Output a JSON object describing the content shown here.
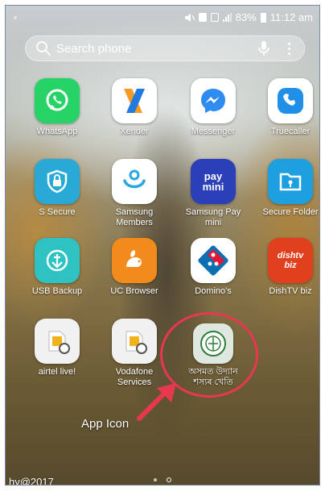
{
  "status_bar": {
    "notification_glyph": "⸗",
    "battery_percent": "83%",
    "time": "11:12 am"
  },
  "search": {
    "placeholder": "Search phone"
  },
  "apps": [
    {
      "name": "whatsapp",
      "label": "WhatsApp",
      "color": "#25d366"
    },
    {
      "name": "xender",
      "label": "Xender",
      "color": "#1f7be0"
    },
    {
      "name": "messenger",
      "label": "Messenger",
      "color": "#2e8cf0"
    },
    {
      "name": "truecaller",
      "label": "Truecaller",
      "color": "#1f8fe8"
    },
    {
      "name": "s-secure",
      "label": "S Secure",
      "color": "#29a9d6"
    },
    {
      "name": "samsung-members",
      "label": "Samsung\nMembers",
      "color": "#2aa6e0"
    },
    {
      "name": "samsung-pay-mini",
      "label": "Samsung Pay\nmini",
      "color": "#2a3fb8",
      "icon_text": "pay\nmini"
    },
    {
      "name": "secure-folder",
      "label": "Secure Folder",
      "color": "#1ea0e0"
    },
    {
      "name": "usb-backup",
      "label": "USB Backup",
      "color": "#2fc2c2"
    },
    {
      "name": "uc-browser",
      "label": "UC Browser",
      "color": "#f28a1c"
    },
    {
      "name": "dominos",
      "label": "Domino's",
      "color": "#0b6fb2"
    },
    {
      "name": "dishtv-biz",
      "label": "DishTV biz",
      "color": "#e1401f",
      "icon_text": "dishtv\nbiz"
    },
    {
      "name": "airtel-live",
      "label": "airtel live!",
      "color": "#f1f1f1"
    },
    {
      "name": "vodafone-services",
      "label": "Vodafone\nServices",
      "color": "#f1f1f1"
    },
    {
      "name": "assam-horticulture",
      "label": "অসমত উদ্যান\nশস্যৰ খেতি",
      "color": "#dfe8e0"
    }
  ],
  "callout": {
    "text": "App Icon",
    "color": "#e8384f"
  },
  "watermark": "hy@2017"
}
